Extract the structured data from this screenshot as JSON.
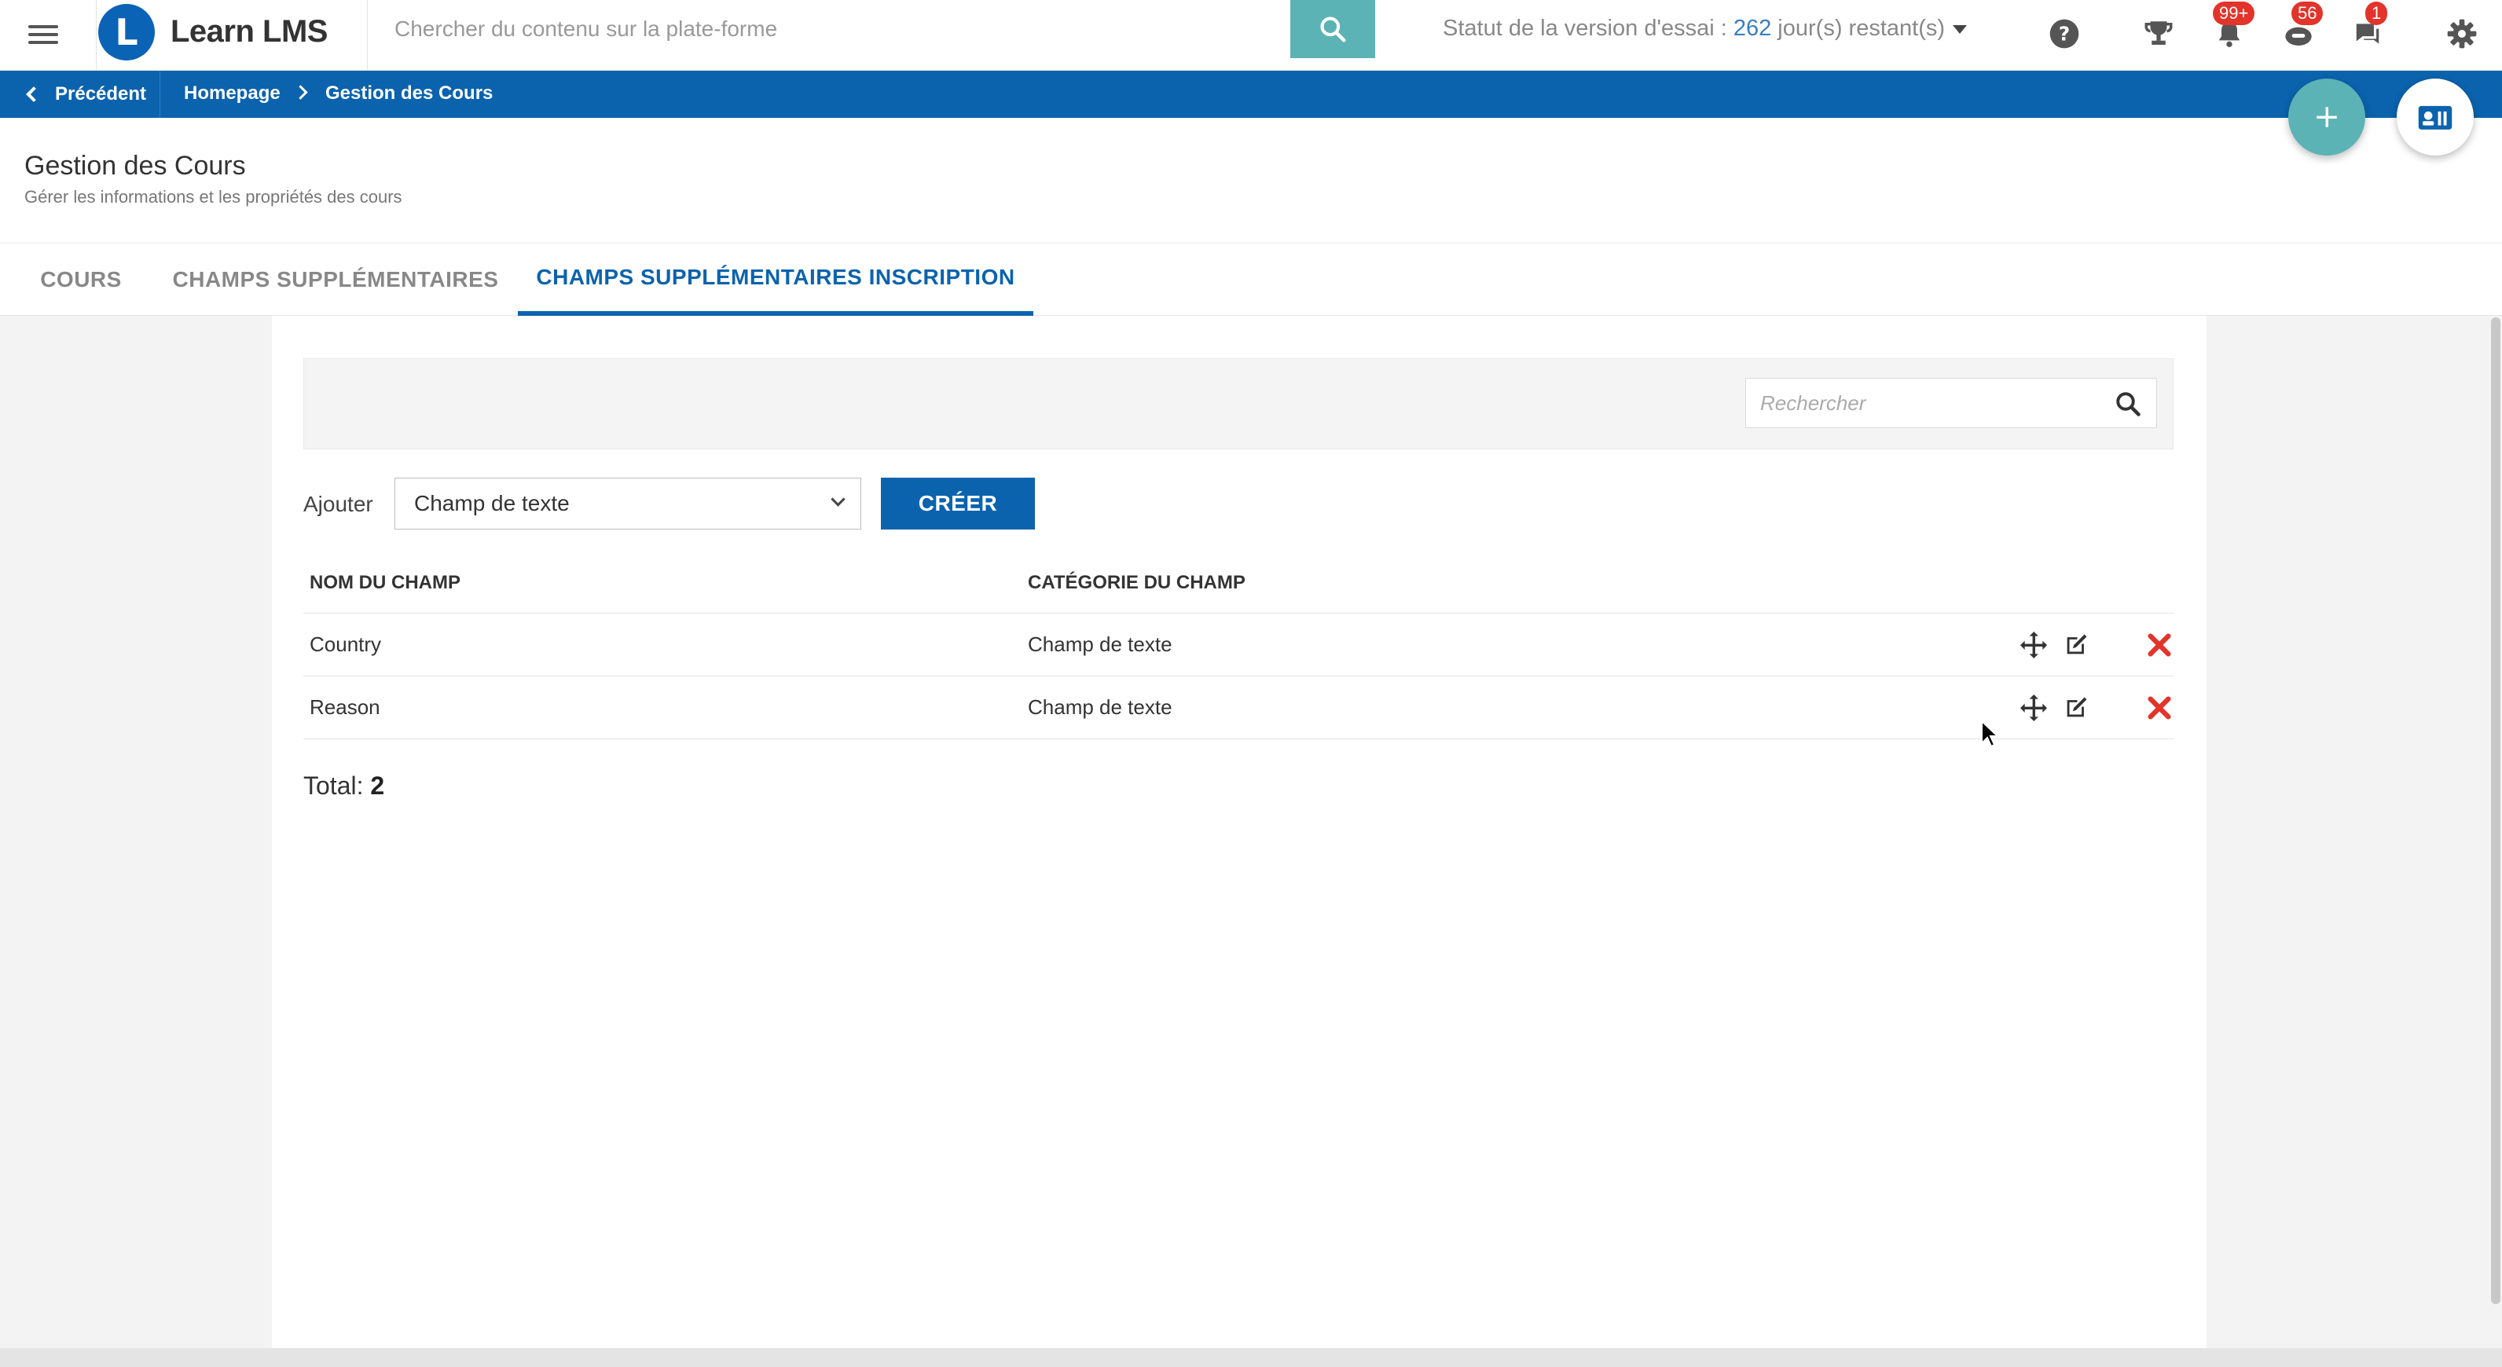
{
  "header": {
    "app_name": "Learn LMS",
    "logo_letter": "L",
    "search_placeholder": "Chercher du contenu sur la plate-forme",
    "trial_prefix": "Statut de la version d'essai : ",
    "trial_days": "262",
    "trial_suffix": " jour(s) restant(s)",
    "badges": {
      "notifications": "99+",
      "messages": "56",
      "chat": "1"
    }
  },
  "breadcrumb": {
    "back_label": "Précédent",
    "home_label": "Homepage",
    "current_label": "Gestion des Cours"
  },
  "page": {
    "title": "Gestion des Cours",
    "subtitle": "Gérer les informations et les propriétés des cours"
  },
  "tabs": [
    {
      "label": "COURS",
      "active": false
    },
    {
      "label": "CHAMPS SUPPLÉMENTAIRES",
      "active": false
    },
    {
      "label": "CHAMPS SUPPLÉMENTAIRES INSCRIPTION",
      "active": true
    }
  ],
  "filter": {
    "search_placeholder": "Rechercher"
  },
  "add_form": {
    "label": "Ajouter",
    "selected_type": "Champ de texte",
    "create_label": "CRÉER"
  },
  "table": {
    "columns": [
      "NOM DU CHAMP",
      "CATÉGORIE DU CHAMP"
    ],
    "rows": [
      {
        "name": "Country",
        "category": "Champ de texte"
      },
      {
        "name": "Reason",
        "category": "Champ de texte"
      }
    ]
  },
  "total": {
    "label": "Total:",
    "value": "2"
  },
  "colors": {
    "primary": "#0b63ad",
    "teal": "#5cb3b6",
    "danger": "#e2342a"
  }
}
